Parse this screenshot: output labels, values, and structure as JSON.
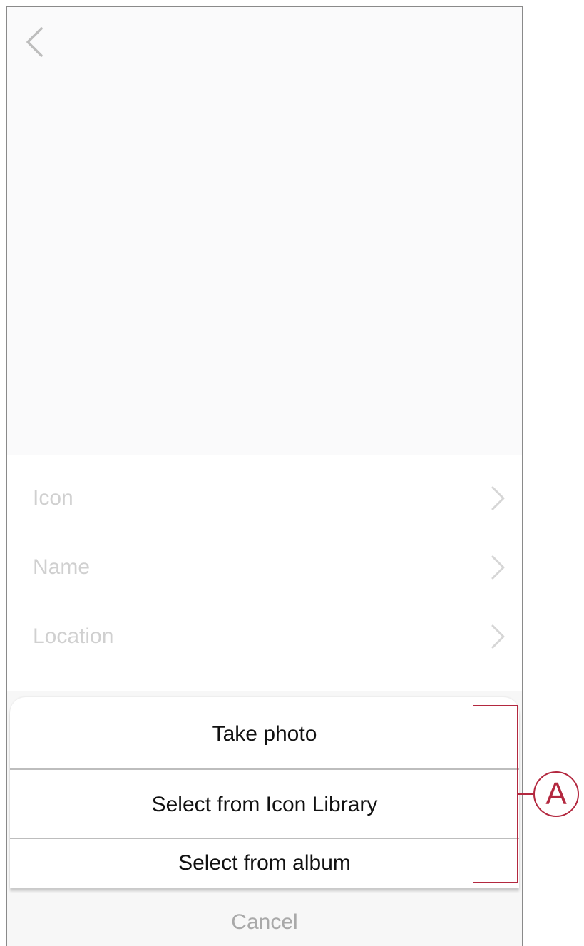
{
  "colors": {
    "accent": "#b3283f",
    "muted_text": "#d0d0d0",
    "cancel_text": "#a9a9a9"
  },
  "nav": {
    "back_icon": "chevron-left-icon"
  },
  "settings": {
    "items": [
      {
        "label": "Icon",
        "icon": "chevron-right-icon"
      },
      {
        "label": "Name",
        "icon": "chevron-right-icon"
      },
      {
        "label": "Location",
        "icon": "chevron-right-icon"
      }
    ]
  },
  "action_sheet": {
    "options": [
      {
        "label": "Take photo"
      },
      {
        "label": "Select from Icon Library"
      },
      {
        "label": "Select from album"
      }
    ],
    "cancel_label": "Cancel"
  },
  "annotation": {
    "letter": "A"
  }
}
